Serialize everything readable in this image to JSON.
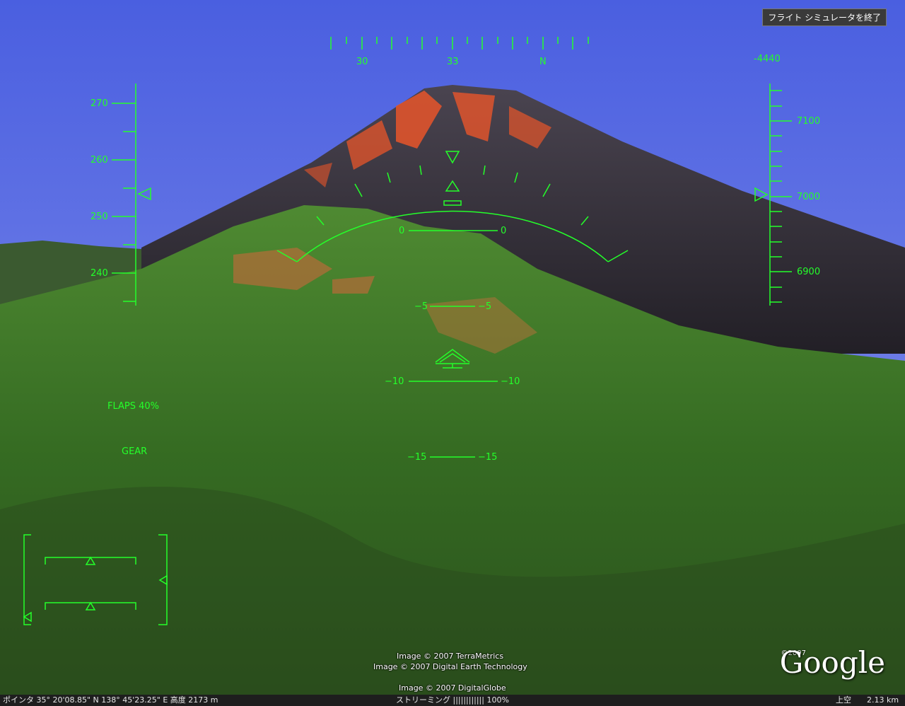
{
  "exit_button": "フライト シミュレータを終了",
  "heading": {
    "labels": [
      "30",
      "33",
      "N"
    ]
  },
  "vertical_speed": "-4440",
  "speed_scale": {
    "labels": [
      "270",
      "260",
      "250",
      "240"
    ]
  },
  "altitude_scale": {
    "labels": [
      "7100",
      "7000",
      "6900"
    ]
  },
  "pitch_ladder": {
    "zero": "0",
    "minus5": "−5",
    "minus10": "−10",
    "minus15": "−15"
  },
  "indicators": {
    "flaps": "FLAPS 40%",
    "gear": "GEAR"
  },
  "credits": {
    "line1": "Image © 2007 TerraMetrics",
    "line2": "Image © 2007 Digital Earth Technology",
    "line3": "Image © 2007 DigitalGlobe"
  },
  "logo": {
    "year": "©2007",
    "text": "Google"
  },
  "status": {
    "pointer": "ポインタ  35° 20'08.85\" N    138° 45'23.25\" E  高度 2173 m",
    "streaming": "ストリーミング ||||||||||||    100%",
    "view_label": "上空",
    "view_alt": "2.13 km"
  },
  "colors": {
    "hud": "#24ff2a",
    "sky": "#5a6fe0",
    "lava": "#e8552a",
    "forest": "#3f7a2a"
  }
}
